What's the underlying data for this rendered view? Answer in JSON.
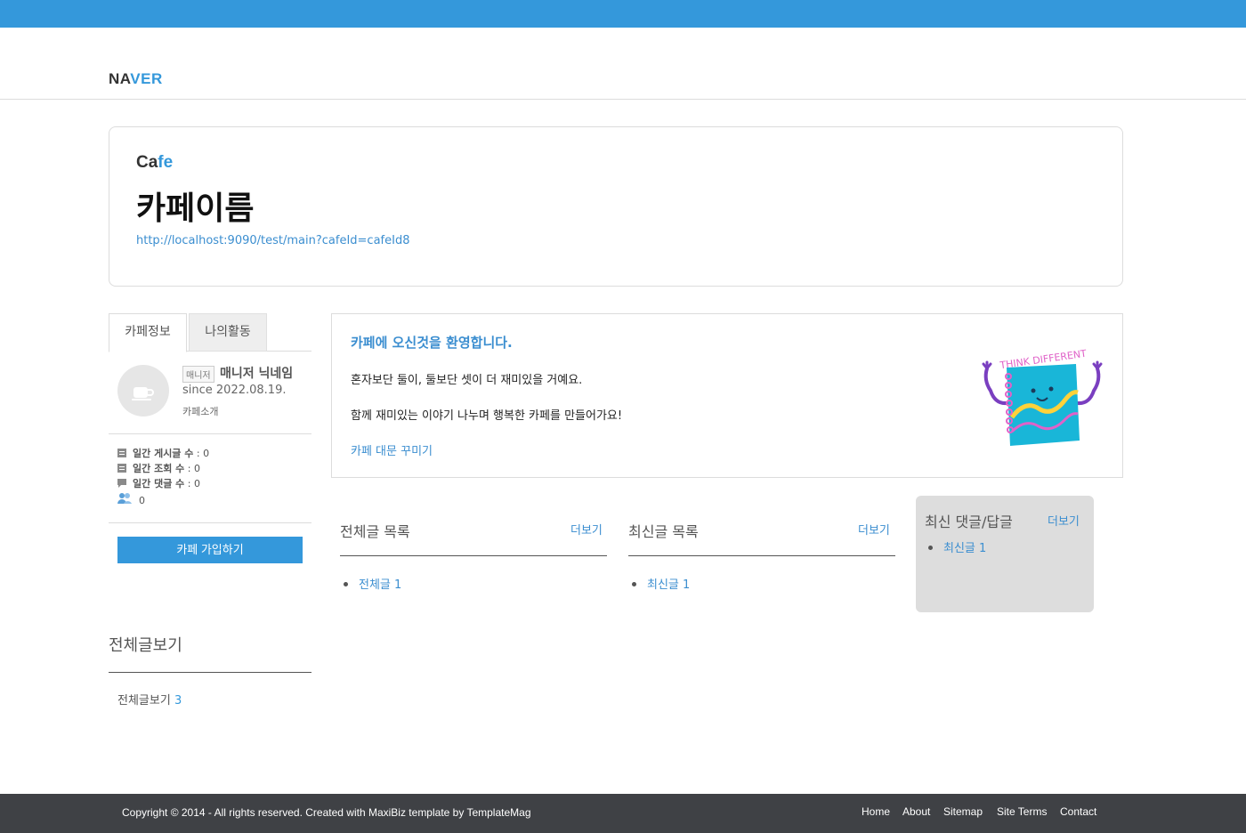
{
  "brand": {
    "part1": "NA",
    "part2": "VER"
  },
  "hero": {
    "cafe_part1": "Ca",
    "cafe_part2": "fe",
    "cafe_name": "카페이름",
    "url": "http://localhost:9090/test/main?cafeId=cafeId8"
  },
  "tabs": [
    "카페정보",
    "나의활동"
  ],
  "profile": {
    "badge": "매니저",
    "nickname": "매니저 닉네임",
    "since": "since 2022.08.19.",
    "intro": "카페소개"
  },
  "stats": [
    {
      "label": "일간 게시글 수",
      "value": " : 0"
    },
    {
      "label": "일간 조회 수",
      "value": " : 0"
    },
    {
      "label": "일간 댓글 수",
      "value": " : 0"
    },
    {
      "label": "",
      "value": "0"
    }
  ],
  "join_button": "카페 가입하기",
  "all_posts": {
    "title": "전체글보기",
    "link": "전체글보기",
    "count": "3"
  },
  "welcome": {
    "title": "카페에 오신것을 환영합니다.",
    "line1": "혼자보단 둘이, 둘보단 셋이 더 재미있을 거예요.",
    "line2": "함께 재미있는 이야기 나누며 행복한 카페를 만들어가요!",
    "link": "카페 대문 꾸미기",
    "image_text": "THINK DIFFERENT"
  },
  "columns": {
    "all": {
      "title": "전체글 목록",
      "more": "더보기",
      "items": [
        "전체글 1"
      ]
    },
    "recent": {
      "title": "최신글 목록",
      "more": "더보기",
      "items": [
        "최신글 1"
      ]
    },
    "comments": {
      "title": "최신 댓글/답글",
      "more": "더보기",
      "items": [
        "최신글 1"
      ]
    }
  },
  "footer": {
    "copyright": "Copyright © 2014 - All rights reserved. Created with MaxiBiz template by TemplateMag",
    "nav": [
      "Home",
      "About",
      "Sitemap",
      "Site Terms",
      "Contact"
    ]
  },
  "colors": {
    "accent": "#3498db",
    "footer": "#3f4145",
    "recent_box": "#dddddd"
  }
}
